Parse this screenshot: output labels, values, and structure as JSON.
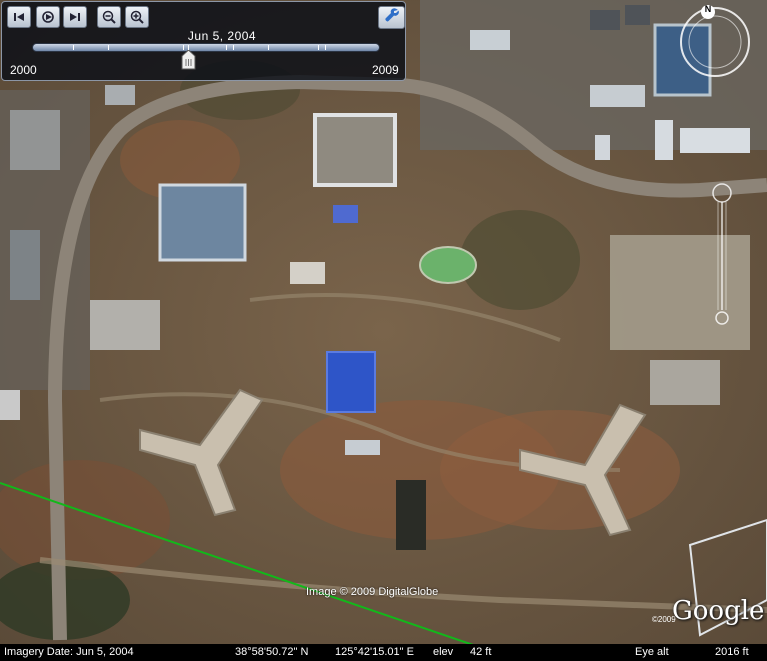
{
  "history": {
    "date": "Jun  5, 2004",
    "year_start": "2000",
    "year_end": "2009",
    "slider_position": 0.45
  },
  "copyright": "Image © 2009 DigitalGlobe",
  "logo": {
    "small_text": "©2009",
    "text": "Google"
  },
  "status": {
    "imagery_date": "Imagery Date: Jun  5, 2004",
    "latitude": "38°58'50.72\" N",
    "longitude": "125°42'15.01\" E",
    "elev_label": "elev",
    "elev_value": "42 ft",
    "eye_alt_label": "Eye alt",
    "eye_alt_value": "2016 ft"
  },
  "compass": {
    "north_label": "N"
  },
  "colors": {
    "boundary_line": "#12b81a",
    "panel_bg": "#0a0e16",
    "ground": "#6e5a44"
  },
  "icons": [
    "rewind-icon",
    "play-icon",
    "forward-icon",
    "zoom-out-icon",
    "zoom-in-icon",
    "wrench-icon",
    "compass-icon",
    "look-joystick-icon",
    "zoom-slider-icon"
  ]
}
